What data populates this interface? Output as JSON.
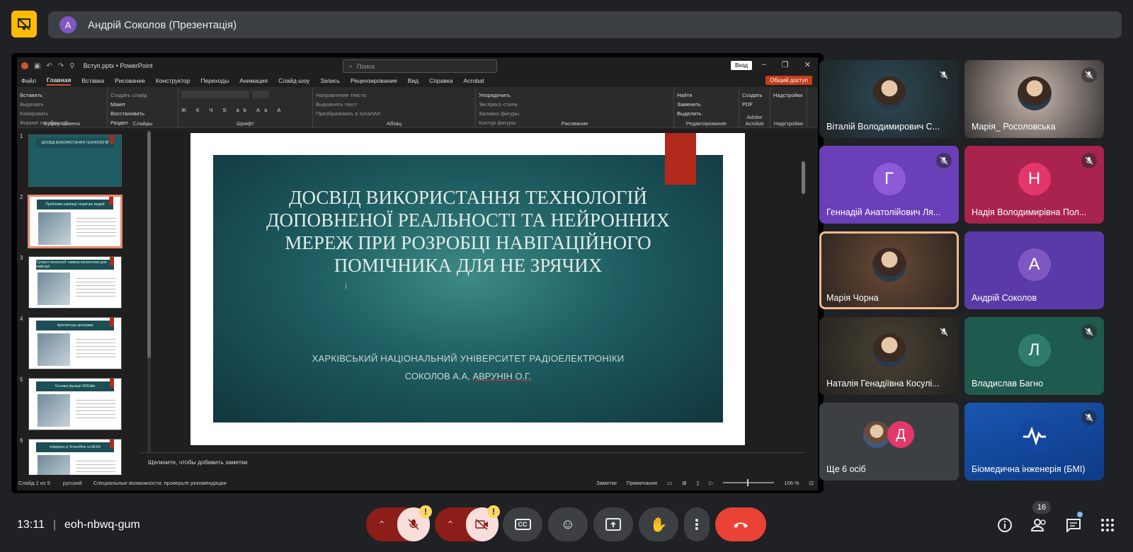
{
  "presenter": {
    "avatar_letter": "А",
    "title": "Андрій Соколов (Презентація)"
  },
  "powerpoint": {
    "filename": "Вступ.pptx  •  PowerPoint",
    "search_placeholder": "Поиск",
    "login": "Вход",
    "share": "Общий доступ",
    "tabs": [
      "Файл",
      "Главная",
      "Вставка",
      "Рисование",
      "Конструктор",
      "Переходы",
      "Анимация",
      "Слайд-шоу",
      "Запись",
      "Рецензирование",
      "Вид",
      "Справка",
      "Acrobat"
    ],
    "ribbon_groups": [
      {
        "label": "Буфер обмена",
        "items": [
          "Вставить",
          "Вырезать",
          "Копировать",
          "Формат по образцу"
        ]
      },
      {
        "label": "Слайды",
        "items": [
          "Создать слайд",
          "Макет",
          "Восстановить",
          "Раздел"
        ]
      },
      {
        "label": "Шрифт",
        "items": []
      },
      {
        "label": "Абзац",
        "items": [
          "Направление текста",
          "Выровнять текст",
          "Преобразовать в SmartArt"
        ]
      },
      {
        "label": "Рисование",
        "items": [
          "Упорядочить",
          "Экспресс-стили",
          "Заливка фигуры",
          "Контур фигуры",
          "Эффекты фигуры"
        ]
      },
      {
        "label": "Редактирование",
        "items": [
          "Найти",
          "Заменить",
          "Выделить"
        ]
      },
      {
        "label": "Adobe Acrobat",
        "items": [
          "Создать PDF"
        ]
      },
      {
        "label": "Надстройки",
        "items": [
          "Надстройки"
        ]
      }
    ],
    "thumbs": [
      {
        "n": "1",
        "title": "ДОСВІД ВИКОРИСТАННЯ ТЕХНОЛОГІЙ"
      },
      {
        "n": "2",
        "title": "Проблеми навігації незрячих людей"
      },
      {
        "n": "3",
        "title": "Сучасні технології: наявна екосистема для навігації"
      },
      {
        "n": "4",
        "title": "Архітектура програми"
      },
      {
        "n": "5",
        "title": "Основні функції VRGlide"
      },
      {
        "n": "6",
        "title": "Інференс в Tensorflow та MLKit"
      }
    ],
    "slide": {
      "title": "ДОСВІД ВИКОРИСТАННЯ ТЕХНОЛОГІЙ\nДОПОВНЕНОЇ РЕАЛЬНОСТІ ТА НЕЙРОННИХ\nМЕРЕЖ ПРИ РОЗРОБЦІ НАВІГАЦІЙНОГО\nПОМІЧНИКА ДЛЯ НЕ ЗРЯЧИХ",
      "university": "ХАРКІВСЬКИЙ НАЦІОНАЛЬНИЙ УНІВЕРСИТЕТ РАДІОЕЛЕКТРОНІКИ",
      "authors_a": "СОКОЛОВ А.А, ",
      "authors_b": "АВРУНІН О.Г."
    },
    "notes_placeholder": "Щелкните, чтобы добавить заметки",
    "status": {
      "slide": "Слайд 2 из 9",
      "lang": "русский",
      "access": "Специальные возможности: проверьте рекомендации",
      "notes": "Заметки",
      "comments": "Примечания",
      "zoom": "106 %"
    }
  },
  "participants": [
    {
      "name": "Віталій Володимирович С...",
      "type": "photo",
      "color": "#2c4a55",
      "muted": true
    },
    {
      "name": "Марія_ Росоловська",
      "type": "photo",
      "color": "#c9b8ae",
      "muted": true
    },
    {
      "name": "Геннадій Анатолійович Ля...",
      "type": "letter",
      "letter": "Г",
      "bg": "#6a3fb8",
      "circle": "#8e5bd6",
      "muted": true
    },
    {
      "name": "Надія Володимирівна Пол...",
      "type": "letter",
      "letter": "Н",
      "bg": "#a8244f",
      "circle": "#e3366b",
      "muted": true
    },
    {
      "name": "Марія Чорна",
      "type": "photo",
      "color": "#6b4a35",
      "muted": false,
      "active": true
    },
    {
      "name": "Андрій Соколов",
      "type": "letter",
      "letter": "А",
      "bg": "#5a3aa8",
      "circle": "#7e57c2",
      "muted": false
    },
    {
      "name": "Наталія Генадіївна Косулі...",
      "type": "photo",
      "color": "#4a4233",
      "muted": true
    },
    {
      "name": "Владислав Багно",
      "type": "letter",
      "letter": "Л",
      "bg": "#1e5a4e",
      "circle": "#2e7d6a",
      "muted": true
    },
    {
      "name": "Ще 6 осіб",
      "type": "group",
      "muted": false
    },
    {
      "name": "Біомедична інженерія (БМІ)",
      "type": "logo",
      "color": "#1a56b0",
      "muted": true
    }
  ],
  "group_letter": "Д",
  "bottom": {
    "time": "13:11",
    "meeting_code": "eoh-nbwq-gum",
    "participants_count": "16"
  },
  "colors": {
    "accent_end": "#ea4335",
    "warning": "#fdd663",
    "muted_group": "#8c1d18"
  }
}
